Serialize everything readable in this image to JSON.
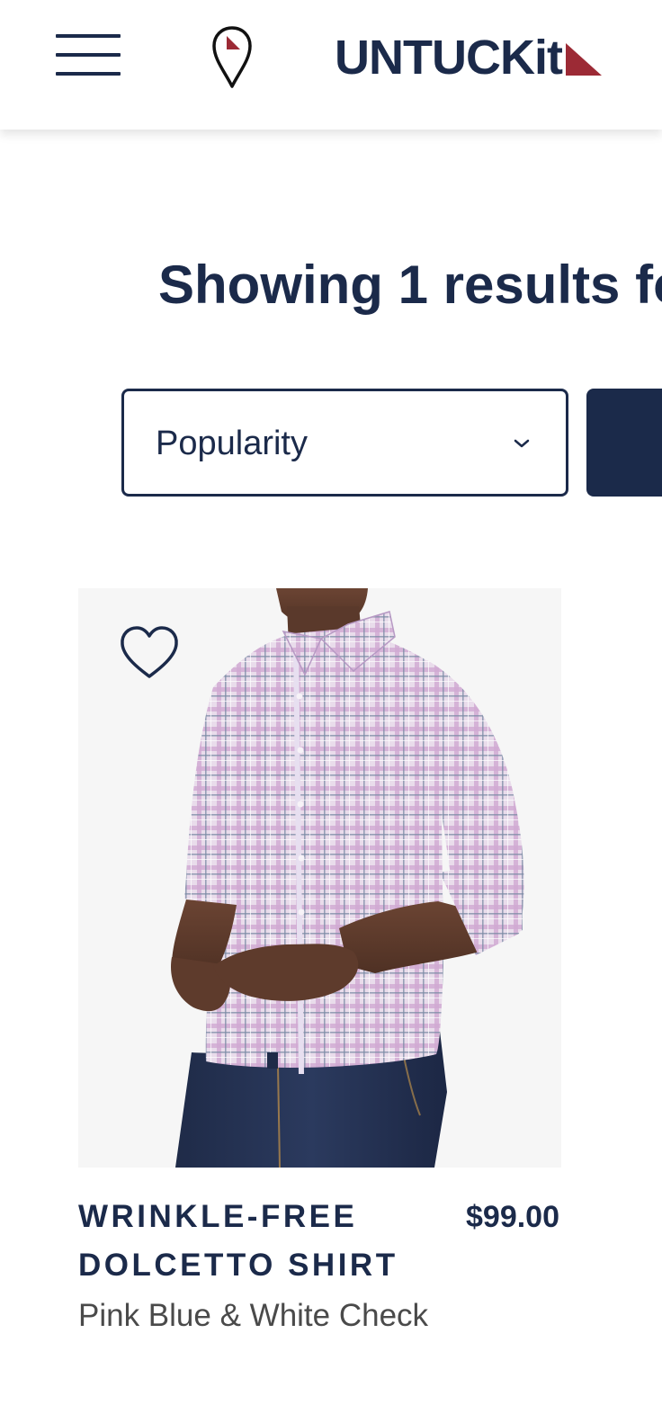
{
  "header": {
    "brand": "UNTUCKit",
    "menu_icon": "hamburger-menu-icon",
    "store_icon": "map-pin-icon",
    "brand_accent_color": "#9c2a35",
    "brand_color": "#1b2a4a"
  },
  "results": {
    "heading": "Showing 1 results fo"
  },
  "sort": {
    "selected": "Popularity",
    "icon": "chevron-down-icon"
  },
  "product": {
    "name": "WRINKLE-FREE DOLCETTO SHIRT",
    "price": "$99.00",
    "color": "Pink Blue & White Check",
    "wishlist_icon": "heart-outline-icon"
  }
}
